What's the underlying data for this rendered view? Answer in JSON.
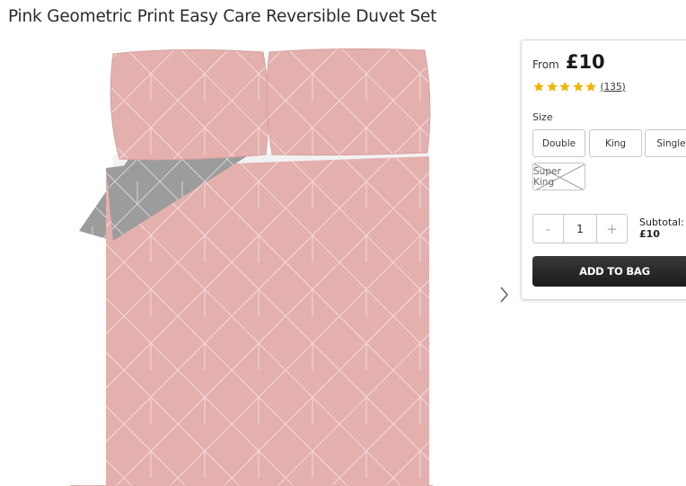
{
  "product": {
    "title": "Pink Geometric Print Easy Care Reversible Duvet Set"
  },
  "image": {
    "description_icon": "duvet-set-product-photo",
    "colors": {
      "pink": "#e3b0ae",
      "grey": "#9e9e9e",
      "line": "#f6dede"
    }
  },
  "price": {
    "prefix": "From",
    "value": "£10"
  },
  "rating": {
    "stars": 5,
    "count_label": "(135)",
    "star_color": "#f0b400"
  },
  "size": {
    "label": "Size",
    "options": [
      {
        "label": "Double",
        "available": true
      },
      {
        "label": "King",
        "available": true
      },
      {
        "label": "Single",
        "available": true
      },
      {
        "label": "Super King",
        "available": false
      }
    ]
  },
  "quantity": {
    "minus": "-",
    "value": "1",
    "plus": "+"
  },
  "subtotal": {
    "label": "Subtotal:",
    "value": "£10"
  },
  "cart": {
    "add_label": "ADD TO BAG"
  },
  "icons": {
    "next": "chevron-right-icon",
    "star": "star-icon"
  }
}
